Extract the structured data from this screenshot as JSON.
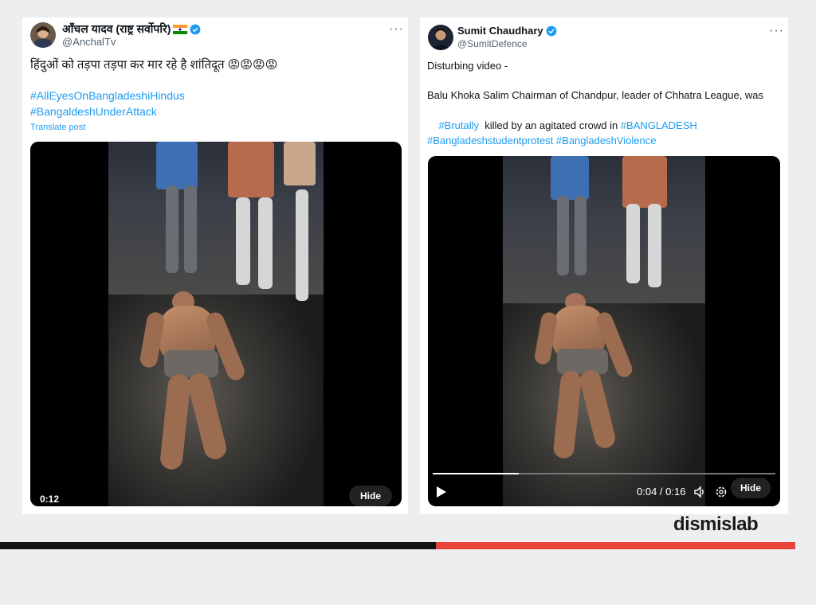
{
  "left_post": {
    "author_name": "आँचल यादव (राष्ट्र सर्वोपरि)",
    "author_handle": "@AnchalTv",
    "text_line": "हिंदुओं को तड़पा तड़पा कर मार रहे है शांतिदूत",
    "emoji": "😡😡😡😡",
    "hashtag_1": "#AllEyesOnBangladeshiHindus",
    "hashtag_2": "#BangaldeshUnderAttack",
    "translate_label": "Translate post",
    "video_timestamp": "0:12",
    "hide_label": "Hide",
    "more_label": "···"
  },
  "right_post": {
    "author_name": "Sumit Chaudhary",
    "author_handle": "@SumitDefence",
    "text_line_1": "Disturbing video -",
    "text_line_2": "Balu Khoka Salim Chairman of Chandpur,  leader of Chhatra League, was",
    "text_line_3_tag": "#Brutally",
    "text_line_3_rest": "  killed by an agitated crowd in ",
    "text_line_3_tag2": "#BANGLADESH",
    "hashtag_line_1": "#Bangladeshstudentprotest",
    "hashtag_line_2": "#BangladeshViolence",
    "video_time": "0:04 / 0:16",
    "video_progress": 0.25,
    "hide_label": "Hide",
    "more_label": "···"
  },
  "logo_text": "dismislab",
  "colors": {
    "link": "#1d9bf0",
    "verified": "#1d9bf0",
    "bar_dark": "#111111",
    "bar_red": "#e8443a"
  }
}
